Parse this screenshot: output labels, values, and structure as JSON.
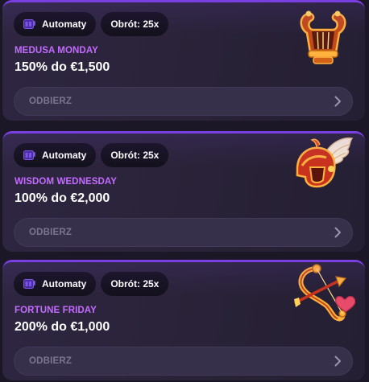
{
  "promotions": [
    {
      "category_tag": "Automaty",
      "spin_tag": "Obrót: 25x",
      "title": "MEDUSA MONDAY",
      "amount": "150% do €1,500",
      "claim_label": "ODBIERZ",
      "art_icon": "lyre-icon"
    },
    {
      "category_tag": "Automaty",
      "spin_tag": "Obrót: 25x",
      "title": "WISDOM WEDNESDAY",
      "amount": "100% do €2,000",
      "claim_label": "ODBIERZ",
      "art_icon": "winged-helmet-icon"
    },
    {
      "category_tag": "Automaty",
      "spin_tag": "Obrót: 25x",
      "title": "FORTUNE FRIDAY",
      "amount": "200% do €1,000",
      "claim_label": "ODBIERZ",
      "art_icon": "bow-and-arrow-icon"
    }
  ],
  "colors": {
    "accent": "#7a3fe0",
    "title": "#c46bff",
    "card_bg": "#2a2339",
    "tag_bg": "#14111d",
    "button_bg": "#36304a",
    "button_text": "#7c7591"
  }
}
